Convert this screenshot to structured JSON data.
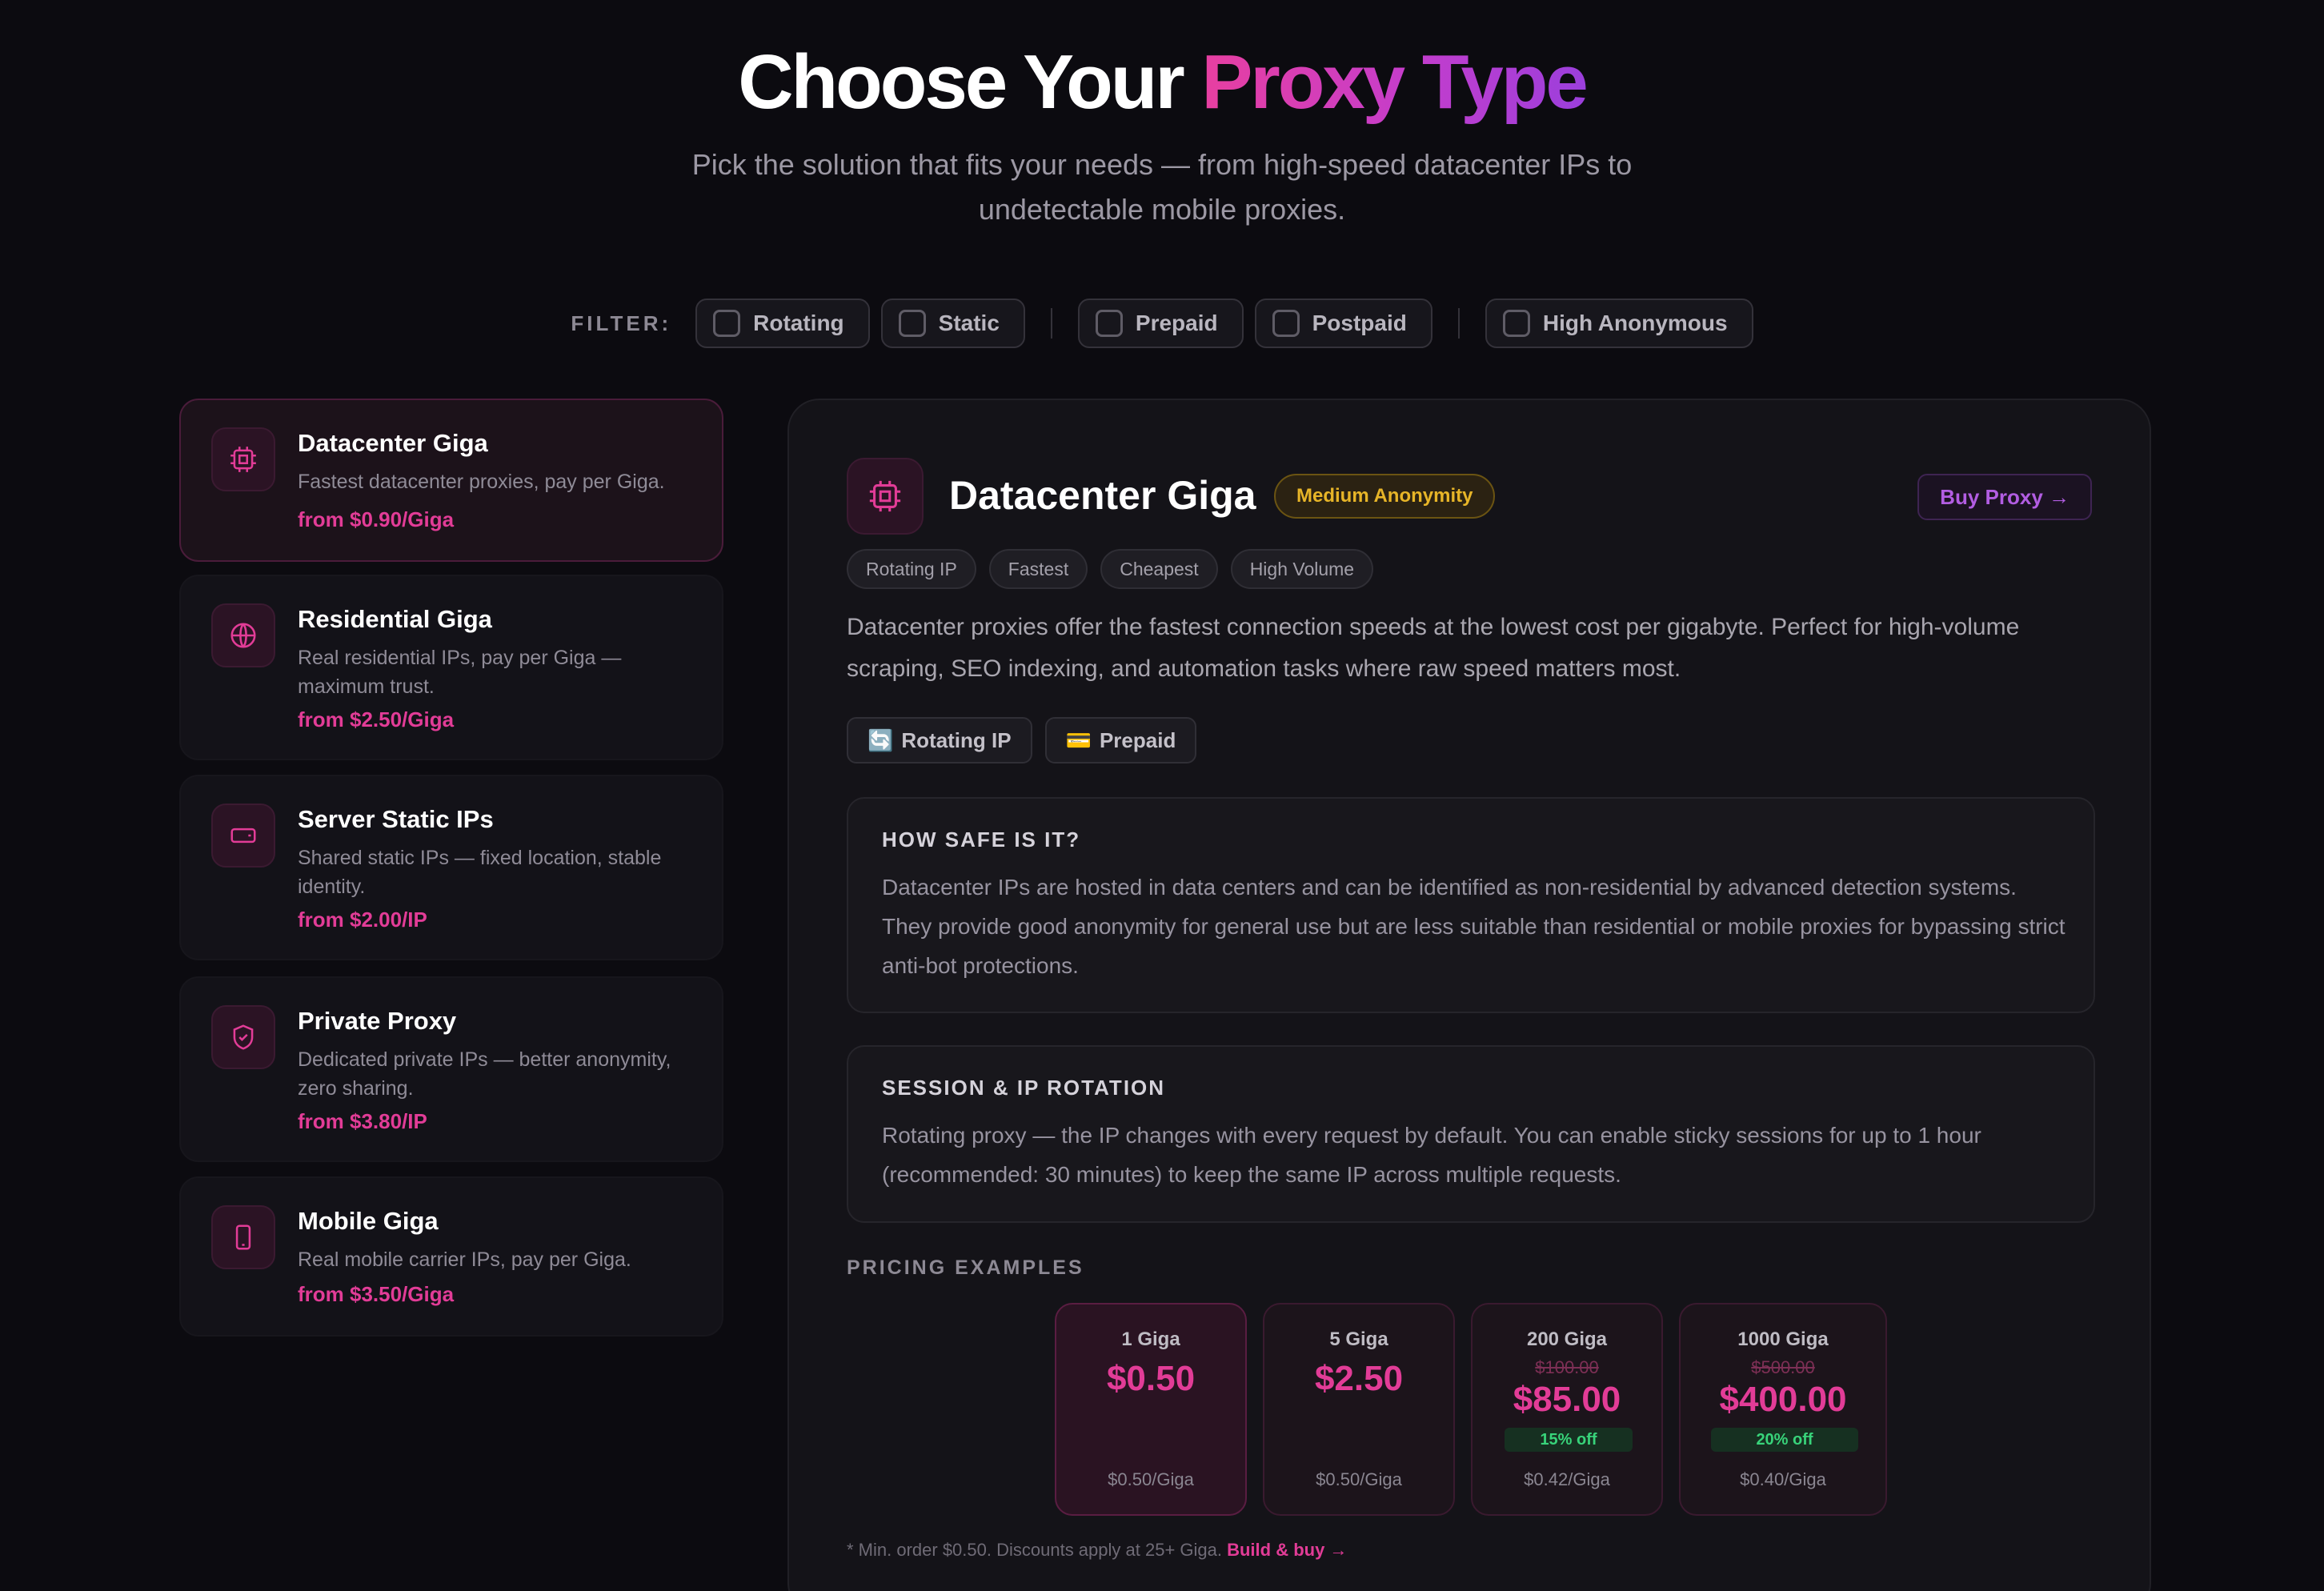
{
  "hero": {
    "title_main": "Choose Your ",
    "title_accent": "Proxy Type",
    "subtitle": "Pick the solution that fits your needs — from high-speed datacenter IPs to undetectable mobile proxies."
  },
  "filters": {
    "label": "FILTER:",
    "options": [
      "Rotating",
      "Static",
      "Prepaid",
      "Postpaid",
      "High Anonymous"
    ]
  },
  "sidebar": {
    "items": [
      {
        "title": "Datacenter Giga",
        "desc": "Fastest datacenter proxies, pay per Giga.",
        "price": "from $0.90/Giga",
        "icon": "cpu-icon"
      },
      {
        "title": "Residential Giga",
        "desc": "Real residential IPs, pay per Giga — maximum trust.",
        "price": "from $2.50/Giga",
        "icon": "globe-icon"
      },
      {
        "title": "Server Static IPs",
        "desc": "Shared static IPs — fixed location, stable identity.",
        "price": "from $2.00/IP",
        "icon": "server-icon"
      },
      {
        "title": "Private Proxy",
        "desc": "Dedicated private IPs — better anonymity, zero sharing.",
        "price": "from $3.80/IP",
        "icon": "shield-check-icon"
      },
      {
        "title": "Mobile Giga",
        "desc": "Real mobile carrier IPs, pay per Giga.",
        "price": "from $3.50/Giga",
        "icon": "mobile-icon"
      }
    ]
  },
  "detail": {
    "title": "Datacenter Giga",
    "badge": "Medium Anonymity",
    "buy_label": "Buy Proxy →",
    "tags": [
      "Rotating IP",
      "Fastest",
      "Cheapest",
      "High Volume"
    ],
    "description": "Datacenter proxies offer the fastest connection speeds at the lowest cost per gigabyte. Perfect for high-volume scraping, SEO indexing, and automation tasks where raw speed matters most.",
    "features": [
      {
        "icon": "🔄",
        "label": "Rotating IP"
      },
      {
        "icon": "💳",
        "label": "Prepaid"
      }
    ],
    "sections": [
      {
        "heading": "HOW SAFE IS IT?",
        "body": "Datacenter IPs are hosted in data centers and can be identified as non-residential by advanced detection systems. They provide good anonymity for general use but are less suitable than residential or mobile proxies for bypassing strict anti-bot protections."
      },
      {
        "heading": "SESSION & IP ROTATION",
        "body": "Rotating proxy — the IP changes with every request by default. You can enable sticky sessions for up to 1 hour (recommended: 30 minutes) to keep the same IP across multiple requests."
      }
    ],
    "pricing_heading": "PRICING EXAMPLES",
    "tiers": [
      {
        "amount": "1 Giga",
        "old": "",
        "price": "$0.50",
        "off": "",
        "unit": "$0.50/Giga"
      },
      {
        "amount": "5 Giga",
        "old": "",
        "price": "$2.50",
        "off": "",
        "unit": "$0.50/Giga"
      },
      {
        "amount": "200 Giga",
        "old": "$100.00",
        "price": "$85.00",
        "off": "15% off",
        "unit": "$0.42/Giga"
      },
      {
        "amount": "1000 Giga",
        "old": "$500.00",
        "price": "$400.00",
        "off": "20% off",
        "unit": "$0.40/Giga"
      }
    ],
    "footnote": "* Min. order $0.50. Discounts apply at 25+ Giga. ",
    "footnote_link": "Build & buy →"
  },
  "colors": {
    "accent": "#e23c97",
    "purple": "#b25de2",
    "warning": "#e7b528",
    "success": "#38d37a",
    "background": "#0c0b10"
  }
}
